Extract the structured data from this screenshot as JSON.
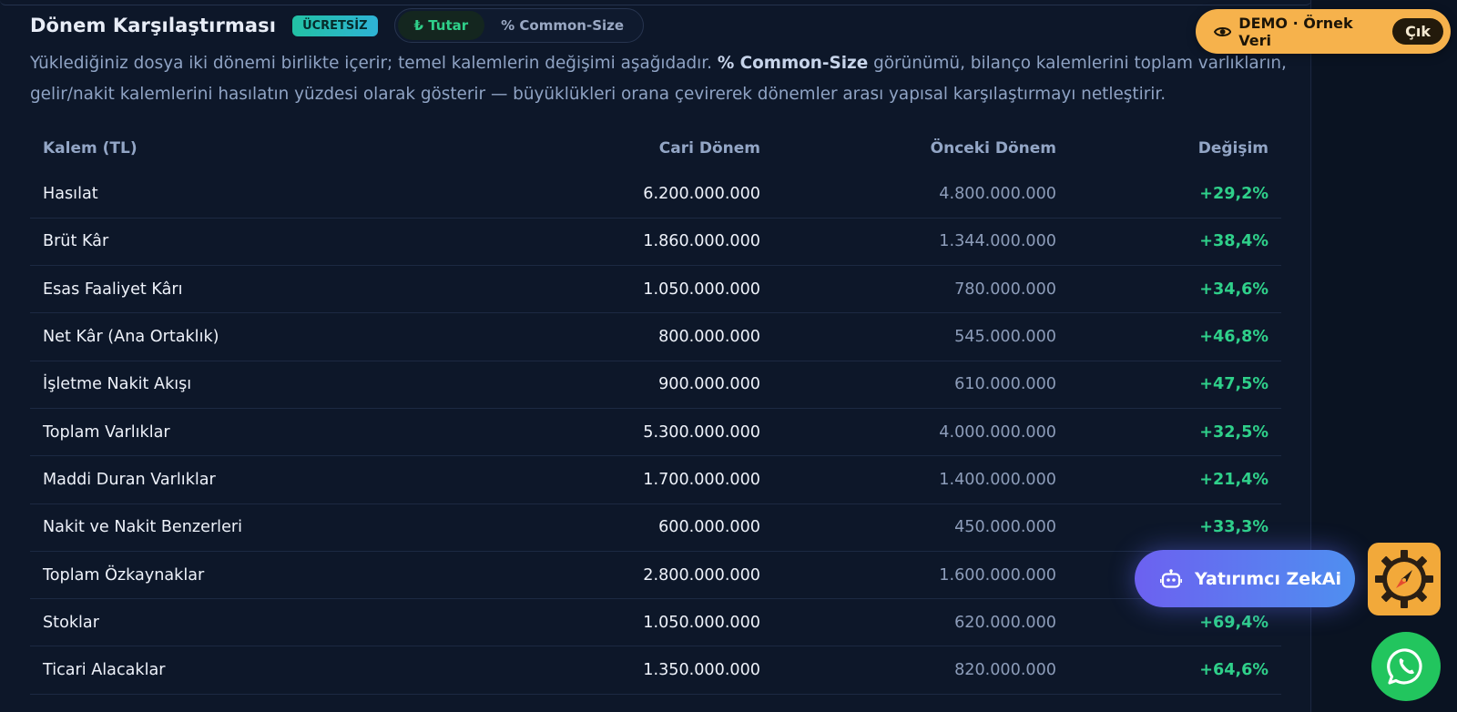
{
  "header": {
    "title": "Dönem Karşılaştırması",
    "badge": "ÜCRETSİZ",
    "toggle": {
      "amount_label": "₺ Tutar",
      "common_size_label": "% Common-Size"
    }
  },
  "intro": {
    "part1": "Yüklediğiniz dosya iki dönemi birlikte içerir; temel kalemlerin değişimi aşağıdadır. ",
    "bold": "% Common-Size",
    "part2": " görünümü, bilanço kalemlerini toplam varlıkların, gelir/nakit kalemlerini hasılatın yüzdesi olarak gösterir — büyüklükleri orana çevirerek dönemler arası yapısal karşılaştırmayı netleştirir."
  },
  "table": {
    "headers": [
      "Kalem (TL)",
      "Cari Dönem",
      "Önceki Dönem",
      "Değişim"
    ],
    "rows": [
      {
        "name": "Hasılat",
        "current": "6.200.000.000",
        "previous": "4.800.000.000",
        "change": "+29,2%"
      },
      {
        "name": "Brüt Kâr",
        "current": "1.860.000.000",
        "previous": "1.344.000.000",
        "change": "+38,4%"
      },
      {
        "name": "Esas Faaliyet Kârı",
        "current": "1.050.000.000",
        "previous": "780.000.000",
        "change": "+34,6%"
      },
      {
        "name": "Net Kâr (Ana Ortaklık)",
        "current": "800.000.000",
        "previous": "545.000.000",
        "change": "+46,8%"
      },
      {
        "name": "İşletme Nakit Akışı",
        "current": "900.000.000",
        "previous": "610.000.000",
        "change": "+47,5%"
      },
      {
        "name": "Toplam Varlıklar",
        "current": "5.300.000.000",
        "previous": "4.000.000.000",
        "change": "+32,5%"
      },
      {
        "name": "Maddi Duran Varlıklar",
        "current": "1.700.000.000",
        "previous": "1.400.000.000",
        "change": "+21,4%"
      },
      {
        "name": "Nakit ve Nakit Benzerleri",
        "current": "600.000.000",
        "previous": "450.000.000",
        "change": "+33,3%"
      },
      {
        "name": "Toplam Özkaynaklar",
        "current": "2.800.000.000",
        "previous": "1.600.000.000",
        "change": ""
      },
      {
        "name": "Stoklar",
        "current": "1.050.000.000",
        "previous": "620.000.000",
        "change": "+69,4%"
      },
      {
        "name": "Ticari Alacaklar",
        "current": "1.350.000.000",
        "previous": "820.000.000",
        "change": "+64,6%"
      }
    ]
  },
  "demo": {
    "label": "DEMO · Örnek Veri",
    "exit_label": "Çık",
    "icon": "eye-icon",
    "color": "#f6b24c"
  },
  "assistant": {
    "label": "Yatırımcı ZekAi",
    "icon": "robot-icon"
  },
  "floating": {
    "gear_icon": "compass-gear-icon",
    "whatsapp_icon": "whatsapp-icon"
  },
  "colors": {
    "positive": "#2fd08a",
    "background": "#0d1729",
    "accent_orange": "#f2a93a",
    "whatsapp_green": "#22c55e"
  }
}
